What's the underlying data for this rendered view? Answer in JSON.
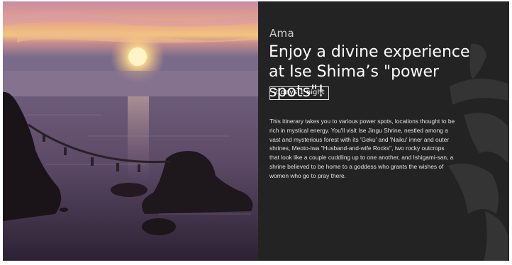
{
  "tour": {
    "area": "Ama",
    "title": "Enjoy a divine experience at Ise Shima’s \"power spots\"!",
    "duration": "2 days 1 night",
    "description": "This itinerary takes you to various power spots, locations thought to be rich in mystical energy. You'll visit Ise Jingu Shrine, nestled among a vast and mysterious forest with its 'Geku' and 'Naiku' inner and outer shrines, Meoto-iwa \"Husband-and-wife Rocks\", two rocky outcrops that look like a couple cuddling up to one another, and Ishigami-san, a shrine believed to be home to a goddess who grants the wishes of women who go to pray there."
  },
  "colors": {
    "panel_background": "#232323",
    "sky_top": "#c98aa0",
    "sun": "#fff3c8",
    "sea": "#5c4a66"
  },
  "icons": {
    "background_art": "calligraphy-brush-strokes"
  }
}
